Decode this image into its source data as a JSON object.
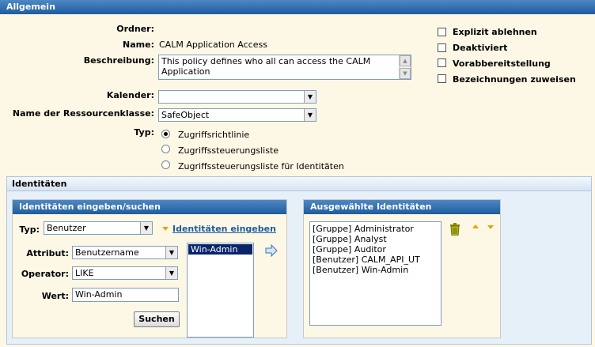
{
  "general": {
    "header": "Allgemein",
    "folder_label": "Ordner:",
    "folder_value": "",
    "name_label": "Name:",
    "name_value": "CALM Application Access",
    "description_label": "Beschreibung:",
    "description_value": "This policy defines who all can access the CALM Application",
    "calendar_label": "Kalender:",
    "calendar_value": "",
    "resource_class_label": "Name der Ressourcenklasse:",
    "resource_class_value": "SafeObject",
    "type_label": "Typ:",
    "type_options": [
      {
        "label": "Zugriffsrichtlinie",
        "selected": true
      },
      {
        "label": "Zugriffssteuerungsliste",
        "selected": false
      },
      {
        "label": "Zugriffssteuerungsliste für Identitäten",
        "selected": false
      }
    ],
    "checkboxes": [
      {
        "label": "Explizit ablehnen",
        "checked": false
      },
      {
        "label": "Deaktiviert",
        "checked": false
      },
      {
        "label": "Vorabbereitstellung",
        "checked": false
      },
      {
        "label": "Bezeichnungen zuweisen",
        "checked": false
      }
    ]
  },
  "identities": {
    "header": "Identitäten",
    "search_panel": {
      "header": "Identitäten eingeben/suchen",
      "type_label": "Typ:",
      "type_value": "Benutzer",
      "enter_link": "Identitäten eingeben",
      "attribute_label": "Attribut:",
      "attribute_value": "Benutzername",
      "operator_label": "Operator:",
      "operator_value": "LIKE",
      "value_label": "Wert:",
      "value_value": "Win-Admin",
      "search_button": "Suchen",
      "results": [
        "Win-Admin"
      ]
    },
    "selected_panel": {
      "header": "Ausgewählte Identitäten",
      "items": [
        "[Gruppe] Administrator",
        "[Gruppe] Analyst",
        "[Gruppe] Auditor",
        "[Benutzer] CALM_API_UT",
        "[Benutzer] Win-Admin"
      ]
    }
  },
  "colors": {
    "header_bg": "#1f5c9d",
    "page_bg": "#fdf8e6",
    "panel_bg": "#e6f0f9",
    "selection_bg": "#0a246a",
    "accent_arrow": "#f0a000"
  }
}
